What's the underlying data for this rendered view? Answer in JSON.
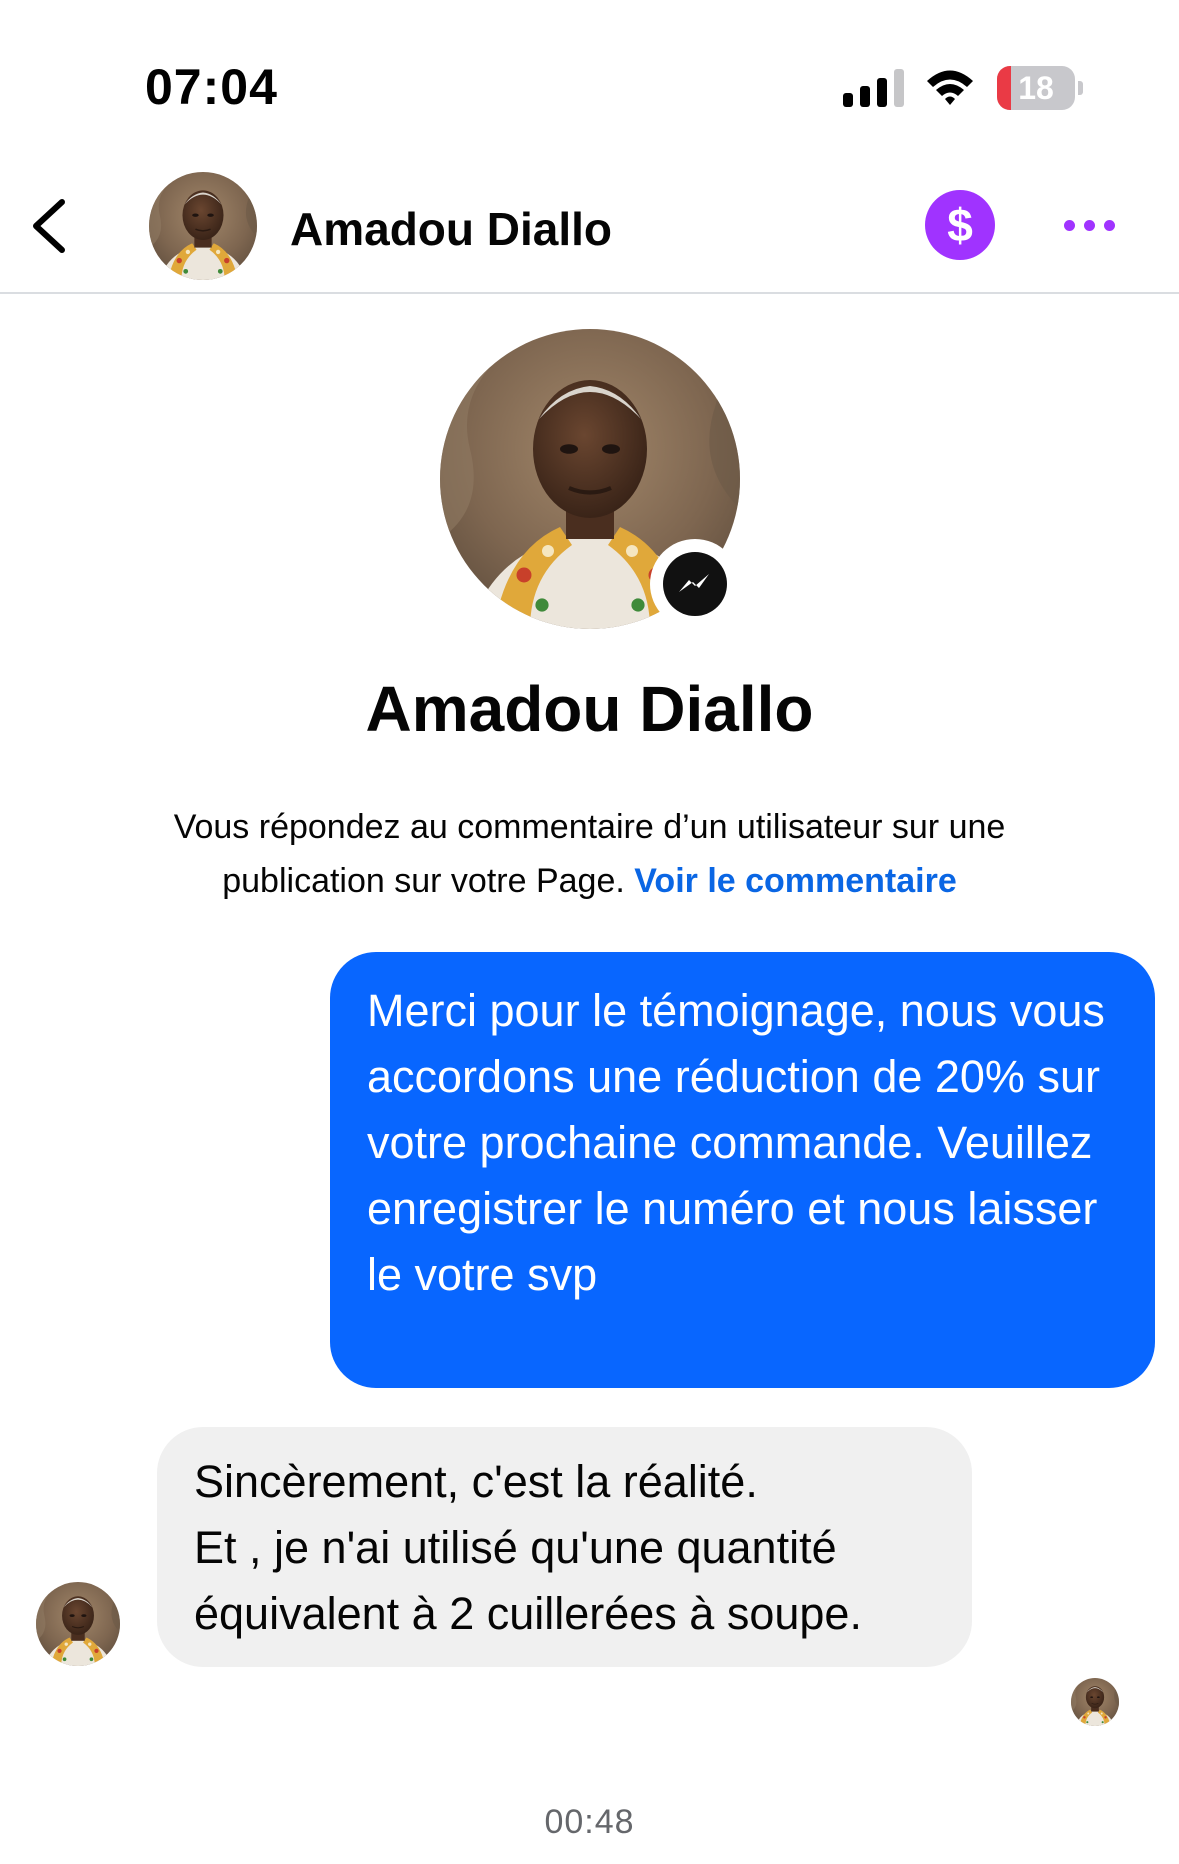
{
  "status_bar": {
    "time": "07:04",
    "battery_level": "18",
    "battery_fraction": 0.18
  },
  "header": {
    "name": "Amadou Diallo",
    "icons": [
      "back-chevron-icon",
      "dollar-icon",
      "more-dots-icon"
    ]
  },
  "profile": {
    "name": "Amadou Diallo",
    "badge_icon": "messenger-icon"
  },
  "context_note": {
    "text": "Vous répondez au commentaire d’un utilisateur sur une publication sur votre Page.",
    "link": "Voir le commentaire"
  },
  "messages": [
    {
      "direction": "outgoing",
      "text": "Merci pour le témoignage, nous vous accordons une réduction de 20% sur votre prochaine commande. Veuillez enregistrer le numéro et nous laisser le votre svp"
    },
    {
      "direction": "incoming",
      "text": "Sincèrement,  c'est la réalité.\nEt , je n'ai utilisé qu'une quantité équivalent à 2 cuillerées à soupe."
    }
  ],
  "timestamp": "00:48",
  "colors": {
    "accent_purple": "#a033ff",
    "outgoing_bubble": "#0866ff",
    "incoming_bubble": "#f0f0f0",
    "link": "#0a66e4",
    "battery_low": "#ea3a45"
  }
}
